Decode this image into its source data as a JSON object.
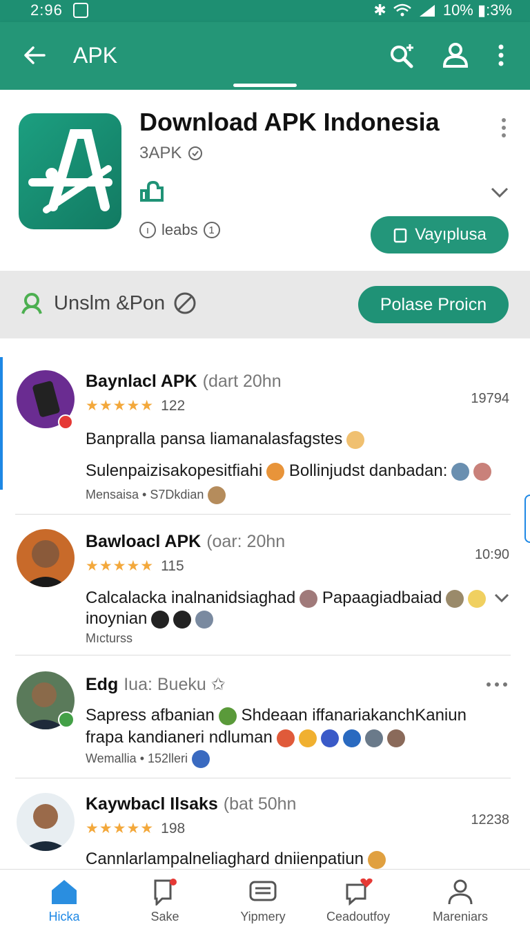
{
  "status_bar": {
    "time": "2:96",
    "battery_text": "10% ▮:3%"
  },
  "app_bar": {
    "title": "APK"
  },
  "app_header": {
    "title": "Download APK Indonesia",
    "developer": "3APK",
    "meta_label": "leabs",
    "meta_count": "1",
    "primary_button": "Vayıplusa"
  },
  "filter_bar": {
    "label": "Unslm &Pon",
    "button": "Polase Proicn"
  },
  "reviews": [
    {
      "name": "Baynlacl APK",
      "sub": "(dart 20hn",
      "stars": "★★★★★",
      "count": "122",
      "time": "19794",
      "line1": "Banpralla pansa liamanalasfagstes",
      "line2": "Sulenpaizisakopesitfiahi",
      "line2b": "Bollinjudst danbadan:",
      "foot": "Mensaisa • S7Dkdian"
    },
    {
      "name": "Bawloacl APK",
      "sub": "(oar: 20hn",
      "stars": "★★★★★",
      "count": "115",
      "time": "10:90",
      "line1": "Calcalacka inalnanidsiaghad",
      "line1b": "Papaagiadbaiad",
      "line2": "inoynian",
      "foot": "Mıcturss"
    },
    {
      "name": "Edg",
      "sub": "Iua: Bueku",
      "line1": "Sapress afbanian",
      "line1b": "Shdeaan iffanariakanchKaniun",
      "line2": "frapa kandianeri ndluman",
      "foot": "Wemallia • 152lleri"
    },
    {
      "name": "Kaywbacl Ilsaks",
      "sub": "(bat 50hn",
      "stars": "★★★★★",
      "count": "198",
      "time": "12238",
      "line1": "Cannlarlampalneliaghard dniienpatiun"
    }
  ],
  "bottom_nav": [
    {
      "label": "Hicka",
      "icon": "home-icon",
      "active": true
    },
    {
      "label": "Sake",
      "icon": "bookmark-icon"
    },
    {
      "label": "Yipmery",
      "icon": "message-icon"
    },
    {
      "label": "Ceadoutfoy",
      "icon": "heart-chat-icon"
    },
    {
      "label": "Mareniars",
      "icon": "profile-icon"
    }
  ],
  "colors": {
    "primary": "#249677",
    "accent_blue": "#1e88e5",
    "star": "#f3a83b"
  }
}
